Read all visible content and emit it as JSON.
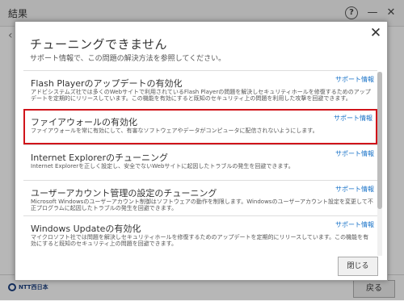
{
  "window": {
    "title": "結果",
    "help_icon": "?",
    "minimize_icon": "—",
    "close_icon": "✕"
  },
  "footer": {
    "brand": "NTT西日本",
    "back_button": "戻る"
  },
  "dialog": {
    "close_icon": "✕",
    "title": "チューニングできません",
    "subtitle": "サポート情報で、この問題の解決方法を参照してください。",
    "close_button": "閉じる",
    "items": [
      {
        "title": "Flash Playerのアップデートの有効化",
        "desc": "アドビシステムズ社では多くのWebサイトで利用されているFlash Playerの問題を解決しセキュリティホールを修復するためのアップデートを定期的にリリースしています。この機能を有効にすると既知のセキュリティ上の問題を利用した攻撃を回避できます。",
        "link": "サポート情報"
      },
      {
        "title": "ファイアウォールの有効化",
        "desc": "ファイアウォールを常に有効にして、有害なソフトウェアやデータがコンピュータに配信されないようにします。",
        "link": "サポート情報"
      },
      {
        "title": "Internet Explorerのチューニング",
        "desc": "Internet Explorerを正しく設定し、安全でないWebサイトに起因したトラブルの発生を回避できます。",
        "link": "サポート情報"
      },
      {
        "title": "ユーザーアカウント管理の設定のチューニング",
        "desc": "Microsoft Windowsのユーザーアカウント制御はソフトウェアの動作を制限します。Windowsのユーザーアカウント設定を変更して不正プログラムに起因したトラブルの発生を回避できます。",
        "link": "サポート情報"
      },
      {
        "title": "Windows Updateの有効化",
        "desc": "マイクロソフト社では問題を解決しセキュリティホールを修復するためのアップデートを定期的にリリースしています。この機能を有効にすると既知のセキュリティ上の問題を回避できます。",
        "link": "サポート情報"
      }
    ]
  },
  "colors": {
    "highlight": "#d0141a",
    "link": "#1a73c8"
  }
}
